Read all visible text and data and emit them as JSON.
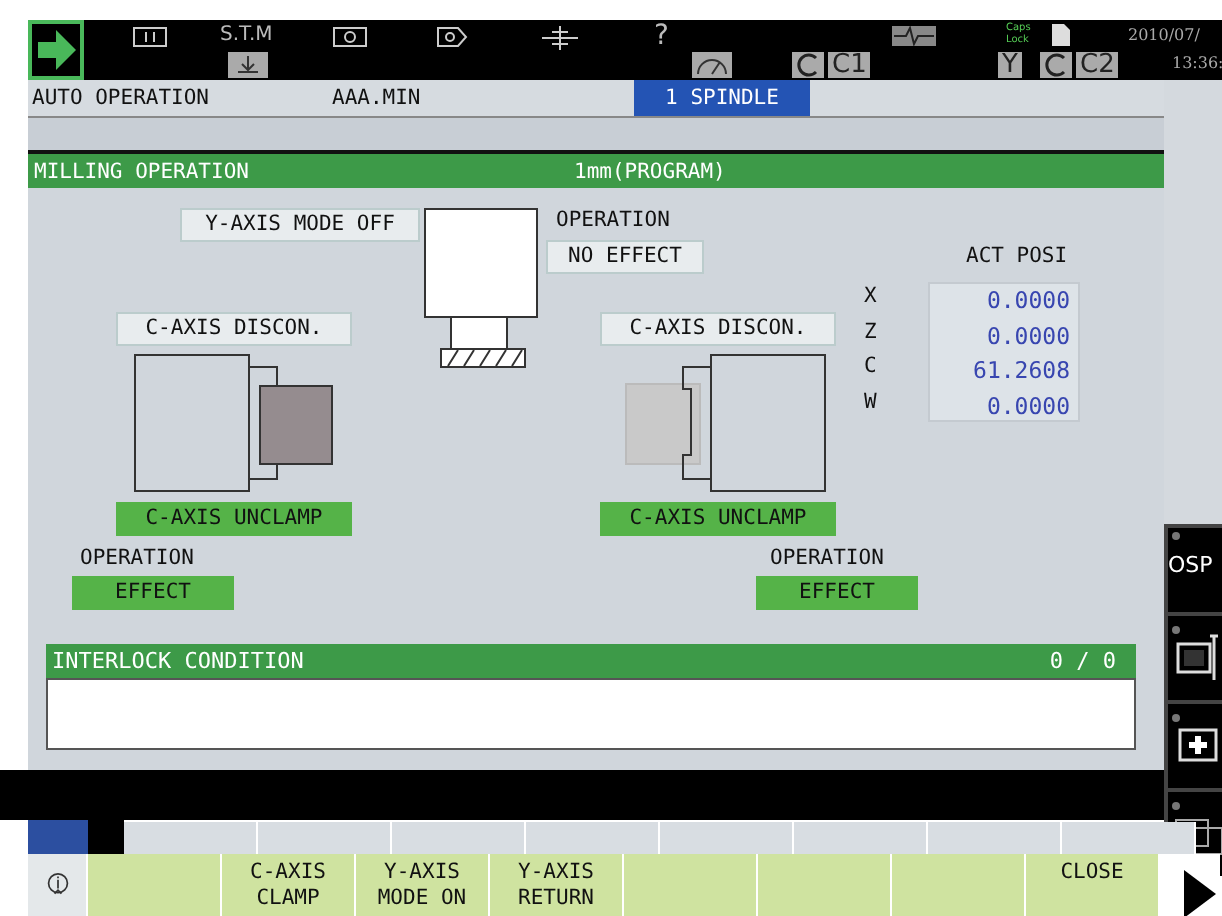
{
  "header": {
    "stm_label": "S.T.M",
    "help_label": "?",
    "c1_label": "C1",
    "caps_lock": "Caps Lock",
    "y_label": "Y",
    "c2_label": "C2",
    "date": "2010/07/",
    "time": "13:36:"
  },
  "status_bar": {
    "mode": "AUTO OPERATION",
    "program": "AAA.MIN",
    "spindle_tab": {
      "label": "1 SPINDLE",
      "selected": true
    }
  },
  "panel": {
    "title": "MILLING OPERATION",
    "subtitle": "1mm(PROGRAM)",
    "y_axis_mode": "Y-AXIS MODE OFF",
    "center_operation": {
      "label": "OPERATION",
      "value": "NO EFFECT",
      "active": false
    },
    "act_posi": {
      "title": "ACT POSI",
      "axes": [
        {
          "axis": "X",
          "value": "0.0000"
        },
        {
          "axis": "Z",
          "value": "0.0000"
        },
        {
          "axis": "C",
          "value": "61.2608"
        },
        {
          "axis": "W",
          "value": "0.0000"
        }
      ]
    },
    "chucks": [
      {
        "kind": "left",
        "status": "C-AXIS DISCON.",
        "clamp": "C-AXIS UNCLAMP",
        "operation_label": "OPERATION",
        "operation": "EFFECT",
        "active": true,
        "color": "#958c8f"
      },
      {
        "kind": "right",
        "status": "C-AXIS DISCON.",
        "clamp": "C-AXIS UNCLAMP",
        "operation_label": "OPERATION",
        "operation": "EFFECT",
        "active": true,
        "color": "#c9c9c9"
      }
    ]
  },
  "interlock": {
    "title": "INTERLOCK CONDITION",
    "count": "0 / 0"
  },
  "softkeys": [
    {
      "kind": "blank"
    },
    {
      "kind": "label",
      "lines": [
        "C-AXIS",
        "CLAMP"
      ]
    },
    {
      "kind": "label",
      "lines": [
        "Y-AXIS",
        "MODE ON"
      ]
    },
    {
      "kind": "label",
      "lines": [
        "Y-AXIS",
        "RETURN"
      ]
    },
    {
      "kind": "blank"
    },
    {
      "kind": "blank"
    },
    {
      "kind": "blank"
    },
    {
      "kind": "label",
      "lines": [
        "CLOSE"
      ]
    }
  ],
  "side_panel": {
    "logo": "OSP"
  }
}
